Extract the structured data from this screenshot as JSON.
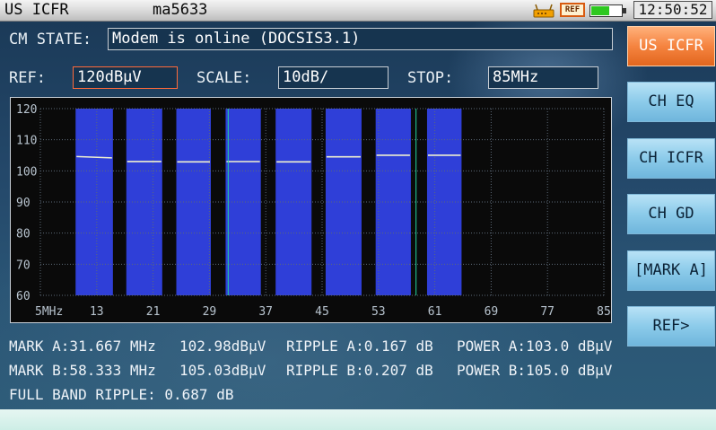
{
  "titlebar": {
    "mode": "US ICFR",
    "device": "ma5633",
    "clock": "12:50:52",
    "ref_badge": "REF"
  },
  "cm_state": {
    "label": "CM STATE:",
    "value": "Modem is online (DOCSIS3.1)"
  },
  "settings": {
    "ref_label": "REF:",
    "ref_value": "120dBμV",
    "scale_label": "SCALE:",
    "scale_value": "10dB/",
    "stop_label": "STOP:",
    "stop_value": "85MHz"
  },
  "chart_data": {
    "type": "bar",
    "x_ticks": [
      "5MHz",
      "13",
      "21",
      "29",
      "37",
      "45",
      "53",
      "61",
      "69",
      "77",
      "85"
    ],
    "y_ticks": [
      "120",
      "110",
      "100",
      "90",
      "80",
      "70",
      "60"
    ],
    "xlim": [
      5,
      85
    ],
    "ylim": [
      60,
      120
    ],
    "channels": [
      {
        "start_mhz": 10.0,
        "end_mhz": 15.3,
        "level": 104.6
      },
      {
        "start_mhz": 17.2,
        "end_mhz": 22.3,
        "level": 103.0
      },
      {
        "start_mhz": 24.3,
        "end_mhz": 29.2,
        "level": 102.9
      },
      {
        "start_mhz": 31.3,
        "end_mhz": 36.3,
        "level": 102.98
      },
      {
        "start_mhz": 38.4,
        "end_mhz": 43.5,
        "level": 102.9
      },
      {
        "start_mhz": 45.5,
        "end_mhz": 50.6,
        "level": 104.5
      },
      {
        "start_mhz": 52.6,
        "end_mhz": 57.6,
        "level": 105.03
      },
      {
        "start_mhz": 59.9,
        "end_mhz": 64.8,
        "level": 105.03
      }
    ],
    "markers_mhz": [
      31.667,
      58.333
    ],
    "grid": true
  },
  "buttons": [
    {
      "label": "US ICFR",
      "active": true
    },
    {
      "label": "CH EQ",
      "active": false
    },
    {
      "label": "CH ICFR",
      "active": false
    },
    {
      "label": "CH GD",
      "active": false
    },
    {
      "label": "[MARK A]",
      "active": false
    },
    {
      "label": "REF>",
      "active": false
    }
  ],
  "readings": {
    "mark_a": "MARK A:31.667 MHz",
    "mark_a_level": "102.98dBμV",
    "ripple_a": "RIPPLE A:0.167 dB",
    "power_a": "POWER A:103.0 dBμV",
    "mark_b": "MARK B:58.333 MHz",
    "mark_b_level": "105.03dBμV",
    "ripple_b": "RIPPLE B:0.207 dB",
    "power_b": "POWER B:105.0 dBμV",
    "full_band": "FULL BAND RIPPLE: 0.687 dB"
  },
  "colors": {
    "bar": "#2f3fd8",
    "trace": "#f0f0d0",
    "marker": "#22d49a",
    "grid": "#5c6a78",
    "active_button": "#f58440",
    "button": "#8ccbea"
  }
}
